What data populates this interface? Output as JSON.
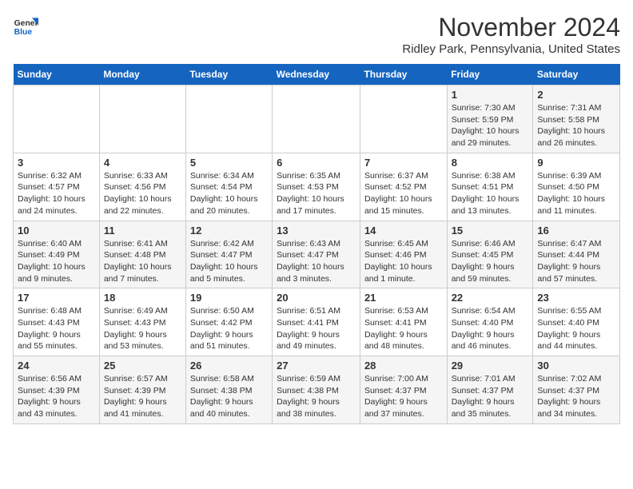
{
  "logo": {
    "line1": "General",
    "line2": "Blue"
  },
  "title": "November 2024",
  "location": "Ridley Park, Pennsylvania, United States",
  "days_of_week": [
    "Sunday",
    "Monday",
    "Tuesday",
    "Wednesday",
    "Thursday",
    "Friday",
    "Saturday"
  ],
  "weeks": [
    [
      {
        "day": "",
        "info": ""
      },
      {
        "day": "",
        "info": ""
      },
      {
        "day": "",
        "info": ""
      },
      {
        "day": "",
        "info": ""
      },
      {
        "day": "",
        "info": ""
      },
      {
        "day": "1",
        "info": "Sunrise: 7:30 AM\nSunset: 5:59 PM\nDaylight: 10 hours\nand 29 minutes."
      },
      {
        "day": "2",
        "info": "Sunrise: 7:31 AM\nSunset: 5:58 PM\nDaylight: 10 hours\nand 26 minutes."
      }
    ],
    [
      {
        "day": "3",
        "info": "Sunrise: 6:32 AM\nSunset: 4:57 PM\nDaylight: 10 hours\nand 24 minutes."
      },
      {
        "day": "4",
        "info": "Sunrise: 6:33 AM\nSunset: 4:56 PM\nDaylight: 10 hours\nand 22 minutes."
      },
      {
        "day": "5",
        "info": "Sunrise: 6:34 AM\nSunset: 4:54 PM\nDaylight: 10 hours\nand 20 minutes."
      },
      {
        "day": "6",
        "info": "Sunrise: 6:35 AM\nSunset: 4:53 PM\nDaylight: 10 hours\nand 17 minutes."
      },
      {
        "day": "7",
        "info": "Sunrise: 6:37 AM\nSunset: 4:52 PM\nDaylight: 10 hours\nand 15 minutes."
      },
      {
        "day": "8",
        "info": "Sunrise: 6:38 AM\nSunset: 4:51 PM\nDaylight: 10 hours\nand 13 minutes."
      },
      {
        "day": "9",
        "info": "Sunrise: 6:39 AM\nSunset: 4:50 PM\nDaylight: 10 hours\nand 11 minutes."
      }
    ],
    [
      {
        "day": "10",
        "info": "Sunrise: 6:40 AM\nSunset: 4:49 PM\nDaylight: 10 hours\nand 9 minutes."
      },
      {
        "day": "11",
        "info": "Sunrise: 6:41 AM\nSunset: 4:48 PM\nDaylight: 10 hours\nand 7 minutes."
      },
      {
        "day": "12",
        "info": "Sunrise: 6:42 AM\nSunset: 4:47 PM\nDaylight: 10 hours\nand 5 minutes."
      },
      {
        "day": "13",
        "info": "Sunrise: 6:43 AM\nSunset: 4:47 PM\nDaylight: 10 hours\nand 3 minutes."
      },
      {
        "day": "14",
        "info": "Sunrise: 6:45 AM\nSunset: 4:46 PM\nDaylight: 10 hours\nand 1 minute."
      },
      {
        "day": "15",
        "info": "Sunrise: 6:46 AM\nSunset: 4:45 PM\nDaylight: 9 hours\nand 59 minutes."
      },
      {
        "day": "16",
        "info": "Sunrise: 6:47 AM\nSunset: 4:44 PM\nDaylight: 9 hours\nand 57 minutes."
      }
    ],
    [
      {
        "day": "17",
        "info": "Sunrise: 6:48 AM\nSunset: 4:43 PM\nDaylight: 9 hours\nand 55 minutes."
      },
      {
        "day": "18",
        "info": "Sunrise: 6:49 AM\nSunset: 4:43 PM\nDaylight: 9 hours\nand 53 minutes."
      },
      {
        "day": "19",
        "info": "Sunrise: 6:50 AM\nSunset: 4:42 PM\nDaylight: 9 hours\nand 51 minutes."
      },
      {
        "day": "20",
        "info": "Sunrise: 6:51 AM\nSunset: 4:41 PM\nDaylight: 9 hours\nand 49 minutes."
      },
      {
        "day": "21",
        "info": "Sunrise: 6:53 AM\nSunset: 4:41 PM\nDaylight: 9 hours\nand 48 minutes."
      },
      {
        "day": "22",
        "info": "Sunrise: 6:54 AM\nSunset: 4:40 PM\nDaylight: 9 hours\nand 46 minutes."
      },
      {
        "day": "23",
        "info": "Sunrise: 6:55 AM\nSunset: 4:40 PM\nDaylight: 9 hours\nand 44 minutes."
      }
    ],
    [
      {
        "day": "24",
        "info": "Sunrise: 6:56 AM\nSunset: 4:39 PM\nDaylight: 9 hours\nand 43 minutes."
      },
      {
        "day": "25",
        "info": "Sunrise: 6:57 AM\nSunset: 4:39 PM\nDaylight: 9 hours\nand 41 minutes."
      },
      {
        "day": "26",
        "info": "Sunrise: 6:58 AM\nSunset: 4:38 PM\nDaylight: 9 hours\nand 40 minutes."
      },
      {
        "day": "27",
        "info": "Sunrise: 6:59 AM\nSunset: 4:38 PM\nDaylight: 9 hours\nand 38 minutes."
      },
      {
        "day": "28",
        "info": "Sunrise: 7:00 AM\nSunset: 4:37 PM\nDaylight: 9 hours\nand 37 minutes."
      },
      {
        "day": "29",
        "info": "Sunrise: 7:01 AM\nSunset: 4:37 PM\nDaylight: 9 hours\nand 35 minutes."
      },
      {
        "day": "30",
        "info": "Sunrise: 7:02 AM\nSunset: 4:37 PM\nDaylight: 9 hours\nand 34 minutes."
      }
    ]
  ]
}
